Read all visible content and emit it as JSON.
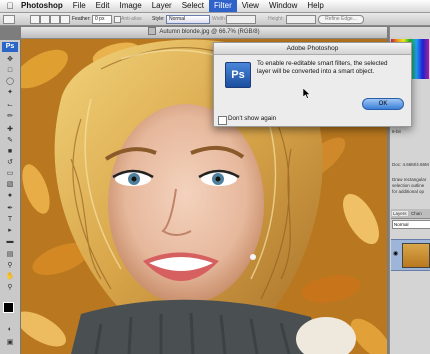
{
  "menubar": {
    "items": [
      "Photoshop",
      "File",
      "Edit",
      "Image",
      "Layer",
      "Select",
      "Filter",
      "View",
      "Window",
      "Help"
    ],
    "active_item": "Filter"
  },
  "options_bar": {
    "feather_label": "Feather:",
    "feather_value": "0 px",
    "antialias_label": "Anti-alias",
    "style_label": "Style:",
    "style_value": "Normal",
    "width_label": "Width:",
    "height_label": "Height:",
    "refine_edge_label": "Refine Edge..."
  },
  "toolbox": {
    "logo": "Ps"
  },
  "document": {
    "title": "Autumn blonde.jpg @ 66.7% (RGB/8)"
  },
  "right_panel": {
    "lines_top": [
      "K:",
      "8-bit"
    ],
    "doc_info": "Doc: 4.66M/4.66M",
    "hint_lines": [
      "Draw rectangular",
      "selection outline",
      "for additional op"
    ],
    "layers_tab": "Layers",
    "channels_tab": "Chan",
    "blend_mode": "Normal"
  },
  "dialog": {
    "title": "Adobe Photoshop",
    "icon_text": "Ps",
    "message": "To enable re-editable smart filters, the selected layer will be converted into a smart object.",
    "ok_label": "OK",
    "checkbox_label": "Don't show again"
  },
  "colors": {
    "menu_highlight": "#2f63c9",
    "ps_blue": "#2a66c8",
    "leaf_orange": "#d08a2a"
  }
}
